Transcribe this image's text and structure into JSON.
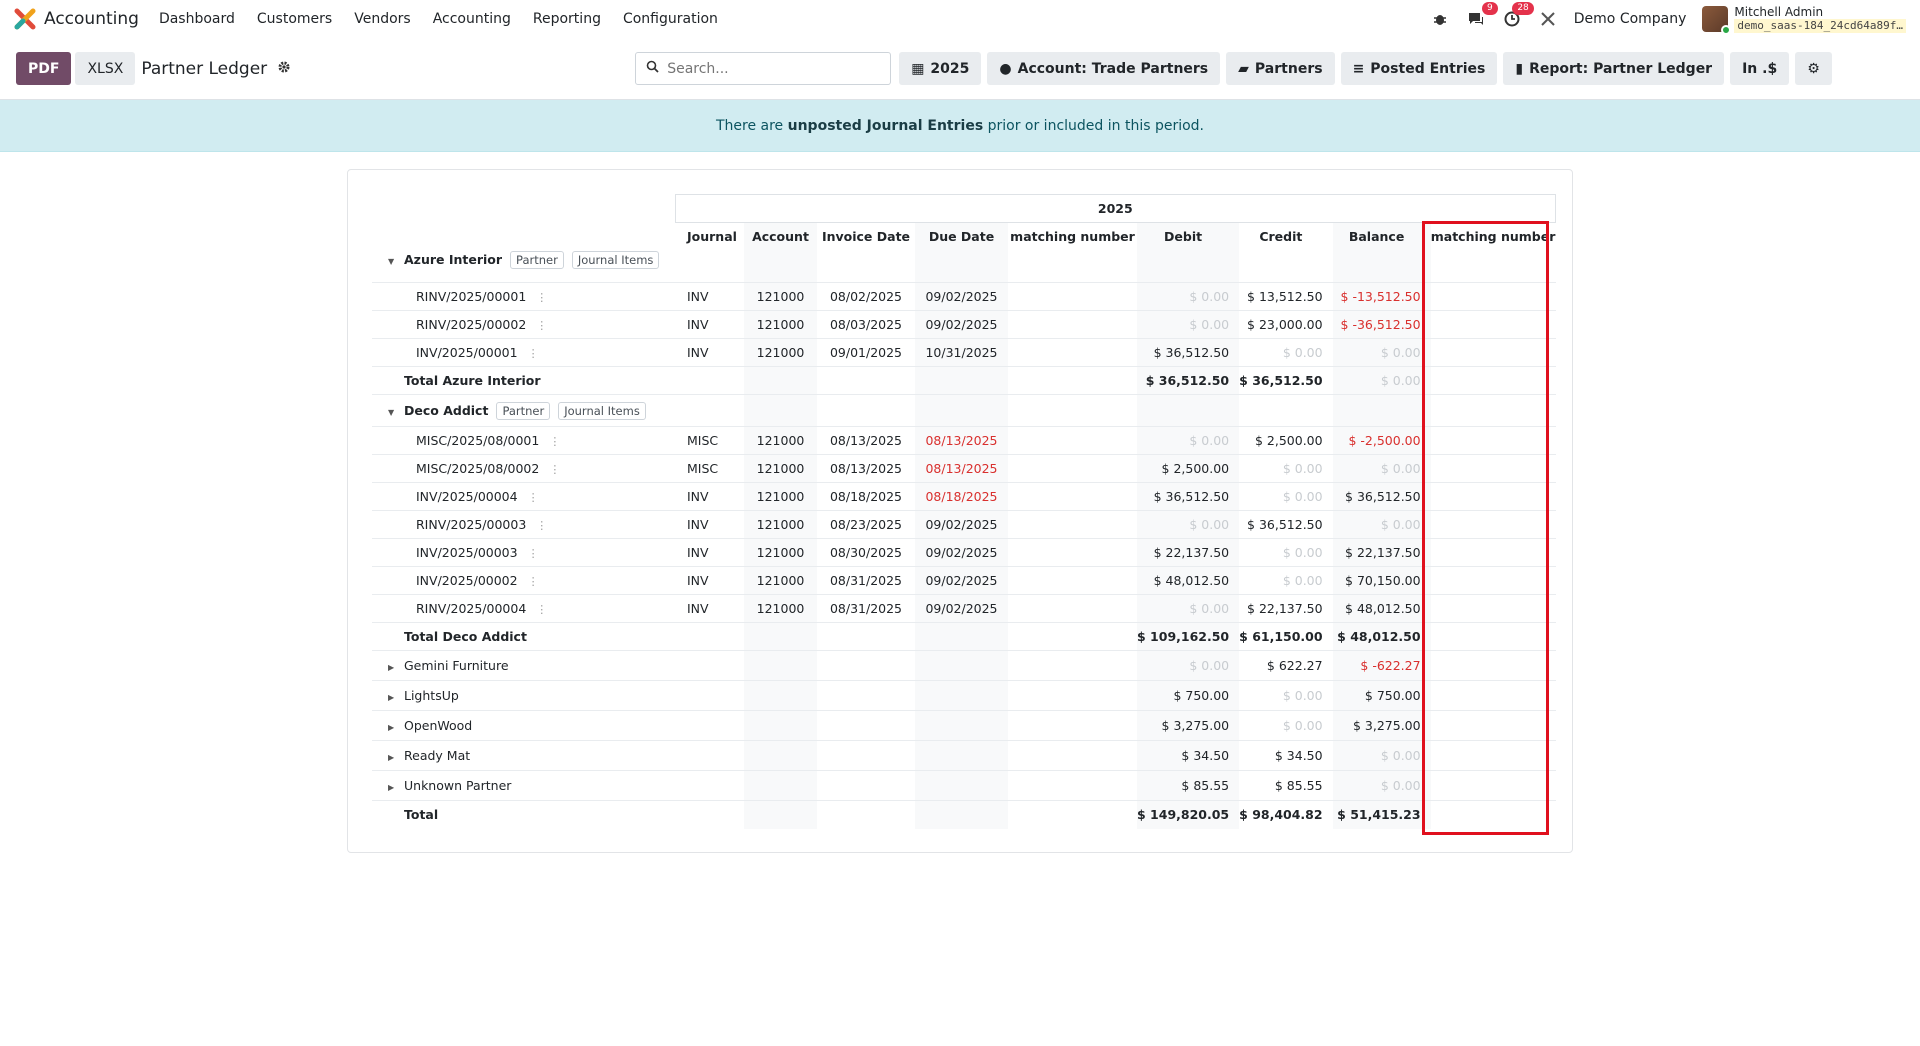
{
  "navbar": {
    "app_name": "Accounting",
    "menu": [
      "Dashboard",
      "Customers",
      "Vendors",
      "Accounting",
      "Reporting",
      "Configuration"
    ],
    "messages_count": "9",
    "activities_count": "28",
    "company": "Demo Company",
    "user_name": "Mitchell Admin",
    "database": "demo_saas-184_24cd64a89f…"
  },
  "control": {
    "pdf_label": "PDF",
    "xlsx_label": "XLSX",
    "title": "Partner Ledger",
    "search_placeholder": "Search...",
    "filters": {
      "date": "2025",
      "account": "Account: Trade Partners",
      "partners": "Partners",
      "posted": "Posted Entries",
      "report": "Report: Partner Ledger",
      "currency": "In .$"
    }
  },
  "alert": {
    "prefix": "There are ",
    "link": "unposted Journal Entries",
    "suffix": " prior or included in this period."
  },
  "report": {
    "period": "2025",
    "columns": [
      "Journal",
      "Account",
      "Invoice Date",
      "Due Date",
      "matching number",
      "Debit",
      "Credit",
      "Balance",
      "matching number"
    ],
    "partner_tag": "Partner",
    "items_tag": "Journal Items",
    "azure": {
      "name": "Azure Interior",
      "lines": [
        {
          "name": "RINV/2025/00001",
          "journal": "INV",
          "account": "121000",
          "idate": "08/02/2025",
          "ddate": "09/02/2025",
          "debit": "$ 0.00",
          "credit": "$ 13,512.50",
          "balance": "$ -13,512.50"
        },
        {
          "name": "RINV/2025/00002",
          "journal": "INV",
          "account": "121000",
          "idate": "08/03/2025",
          "ddate": "09/02/2025",
          "debit": "$ 0.00",
          "credit": "$ 23,000.00",
          "balance": "$ -36,512.50"
        },
        {
          "name": "INV/2025/00001",
          "journal": "INV",
          "account": "121000",
          "idate": "09/01/2025",
          "ddate": "10/31/2025",
          "debit": "$ 36,512.50",
          "credit": "$ 0.00",
          "balance": "$ 0.00"
        }
      ],
      "total_label": "Total Azure Interior",
      "total": {
        "debit": "$ 36,512.50",
        "credit": "$ 36,512.50",
        "balance": "$ 0.00"
      }
    },
    "deco": {
      "name": "Deco Addict",
      "lines": [
        {
          "name": "MISC/2025/08/0001",
          "journal": "MISC",
          "account": "121000",
          "idate": "08/13/2025",
          "ddate": "08/13/2025",
          "debit": "$ 0.00",
          "credit": "$ 2,500.00",
          "balance": "$ -2,500.00"
        },
        {
          "name": "MISC/2025/08/0002",
          "journal": "MISC",
          "account": "121000",
          "idate": "08/13/2025",
          "ddate": "08/13/2025",
          "debit": "$ 2,500.00",
          "credit": "$ 0.00",
          "balance": "$ 0.00"
        },
        {
          "name": "INV/2025/00004",
          "journal": "INV",
          "account": "121000",
          "idate": "08/18/2025",
          "ddate": "08/18/2025",
          "debit": "$ 36,512.50",
          "credit": "$ 0.00",
          "balance": "$ 36,512.50"
        },
        {
          "name": "RINV/2025/00003",
          "journal": "INV",
          "account": "121000",
          "idate": "08/23/2025",
          "ddate": "09/02/2025",
          "debit": "$ 0.00",
          "credit": "$ 36,512.50",
          "balance": "$ 0.00"
        },
        {
          "name": "INV/2025/00003",
          "journal": "INV",
          "account": "121000",
          "idate": "08/30/2025",
          "ddate": "09/02/2025",
          "debit": "$ 22,137.50",
          "credit": "$ 0.00",
          "balance": "$ 22,137.50"
        },
        {
          "name": "INV/2025/00002",
          "journal": "INV",
          "account": "121000",
          "idate": "08/31/2025",
          "ddate": "09/02/2025",
          "debit": "$ 48,012.50",
          "credit": "$ 0.00",
          "balance": "$ 70,150.00"
        },
        {
          "name": "RINV/2025/00004",
          "journal": "INV",
          "account": "121000",
          "idate": "08/31/2025",
          "ddate": "09/02/2025",
          "debit": "$ 0.00",
          "credit": "$ 22,137.50",
          "balance": "$ 48,012.50"
        }
      ],
      "total_label": "Total Deco Addict",
      "total": {
        "debit": "$ 109,162.50",
        "credit": "$ 61,150.00",
        "balance": "$ 48,012.50"
      }
    },
    "collapsed": [
      {
        "name": "Gemini Furniture",
        "debit": "$ 0.00",
        "credit": "$ 622.27",
        "balance": "$ -622.27"
      },
      {
        "name": "LightsUp",
        "debit": "$ 750.00",
        "credit": "$ 0.00",
        "balance": "$ 750.00"
      },
      {
        "name": "OpenWood",
        "debit": "$ 3,275.00",
        "credit": "$ 0.00",
        "balance": "$ 3,275.00"
      },
      {
        "name": "Ready Mat",
        "debit": "$ 34.50",
        "credit": "$ 34.50",
        "balance": "$ 0.00"
      },
      {
        "name": "Unknown Partner",
        "debit": "$ 85.55",
        "credit": "$ 85.55",
        "balance": "$ 0.00"
      }
    ],
    "grand_total": {
      "label": "Total",
      "debit": "$ 149,820.05",
      "credit": "$ 98,404.82",
      "balance": "$ 51,415.23"
    }
  }
}
